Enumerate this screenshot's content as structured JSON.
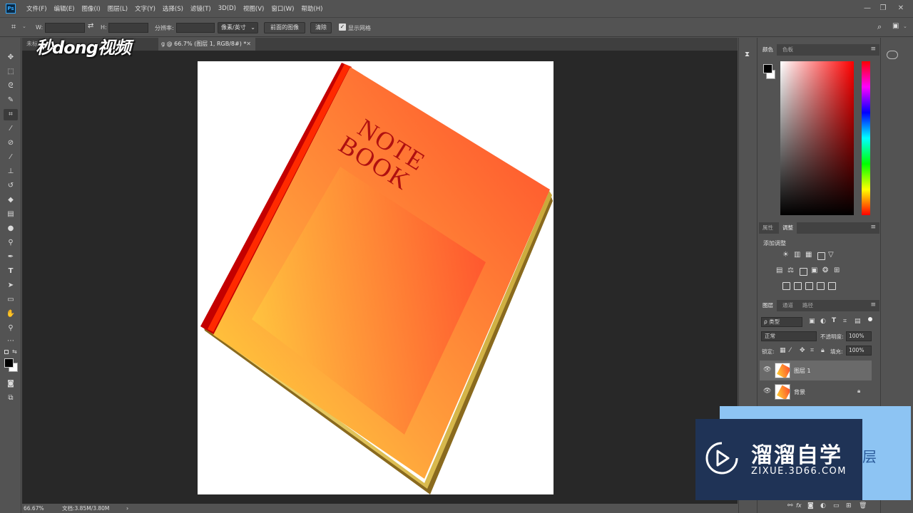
{
  "app": {
    "logo_text": "Ps",
    "menu": [
      "文件(F)",
      "编辑(E)",
      "图像(I)",
      "图层(L)",
      "文字(Y)",
      "选择(S)",
      "滤镜(T)",
      "3D(D)",
      "视图(V)",
      "窗口(W)",
      "帮助(H)"
    ],
    "window_controls": [
      "—",
      "❐",
      "✕"
    ]
  },
  "options_bar": {
    "w_label": "W:",
    "h_label": "H:",
    "resolution_label": "分辨率:",
    "unit_select": "像素/英寸",
    "front_image_button": "前面的图像",
    "clear_button": "清除",
    "show_grid_label": "显示网格",
    "show_grid_checked": true
  },
  "document": {
    "tab_inactive": "未标",
    "tab_active": "g @ 66.7% (图层 1, RGB/8#) *",
    "tab_close": "✕",
    "cover_title_line1": "NOTE",
    "cover_title_line2": "BOOK",
    "artwork": "orange notebook illustration"
  },
  "status_bar": {
    "zoom": "66.67%",
    "doc_size": "文档:3.85M/3.80M"
  },
  "color_panel": {
    "tabs": [
      "颜色",
      "色板"
    ],
    "foreground": "#000000",
    "background": "#ffffff",
    "hue": "#ff0000"
  },
  "adjust_panel": {
    "tabs": [
      "属性",
      "调整"
    ],
    "add_adjustment": "添加调整"
  },
  "layers_panel": {
    "tabs": [
      "图层",
      "通道",
      "路径"
    ],
    "filter_kind": "ρ 类型",
    "blend_mode": "正常",
    "opacity_label": "不透明度:",
    "opacity_value": "100%",
    "lock_label": "锁定:",
    "fill_label": "填充:",
    "fill_value": "100%",
    "layers": [
      {
        "name": "图层 1",
        "selected": true,
        "locked": false
      },
      {
        "name": "背景",
        "selected": false,
        "locked": true
      }
    ],
    "footer_fx": "fx"
  },
  "watermarks": {
    "top_left": "秒dong视频",
    "bottom_right_title": "溜溜自学",
    "bottom_right_url": "ZIXUE.3D66.COM",
    "behind_text": "层"
  }
}
